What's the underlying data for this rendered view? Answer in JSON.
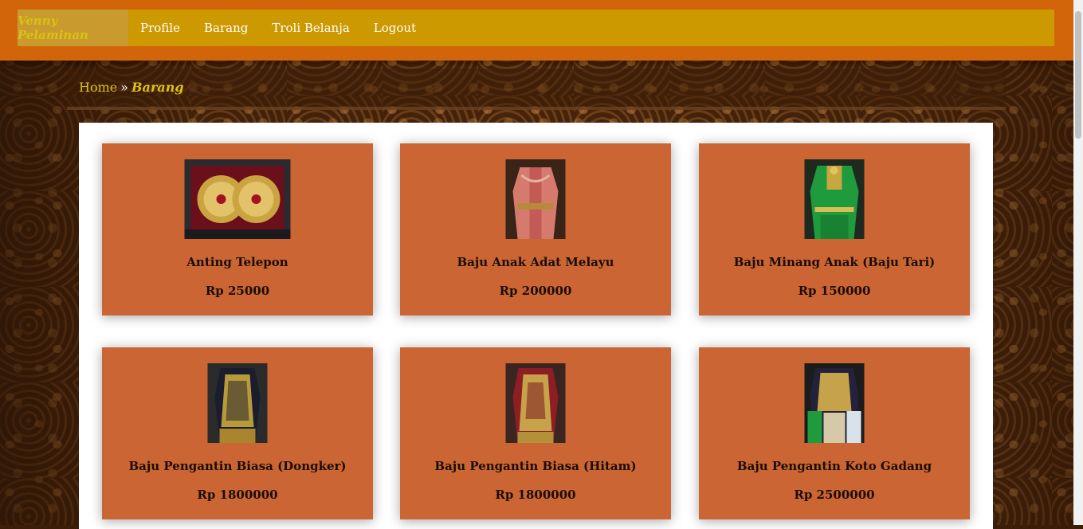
{
  "nav": {
    "brand": "Venny Pelaminan",
    "links": [
      "Profile",
      "Barang",
      "Troli Belanja",
      "Logout"
    ]
  },
  "breadcrumb": {
    "home": "Home",
    "separator": "»",
    "current": "Barang"
  },
  "products": [
    {
      "name": "Anting Telepon",
      "price": "Rp 25000"
    },
    {
      "name": "Baju Anak Adat Melayu",
      "price": "Rp 200000"
    },
    {
      "name": "Baju Minang Anak (Baju Tari)",
      "price": "Rp 150000"
    },
    {
      "name": "Baju Pengantin Biasa (Dongker)",
      "price": "Rp 1800000"
    },
    {
      "name": "Baju Pengantin Biasa (Hitam)",
      "price": "Rp 1800000"
    },
    {
      "name": "Baju Pengantin Koto Gadang",
      "price": "Rp 2500000"
    }
  ],
  "colors": {
    "topbar": "#d2640a",
    "nav": "#cc9900",
    "card": "#cb6533",
    "brand_text": "#d9c313"
  }
}
